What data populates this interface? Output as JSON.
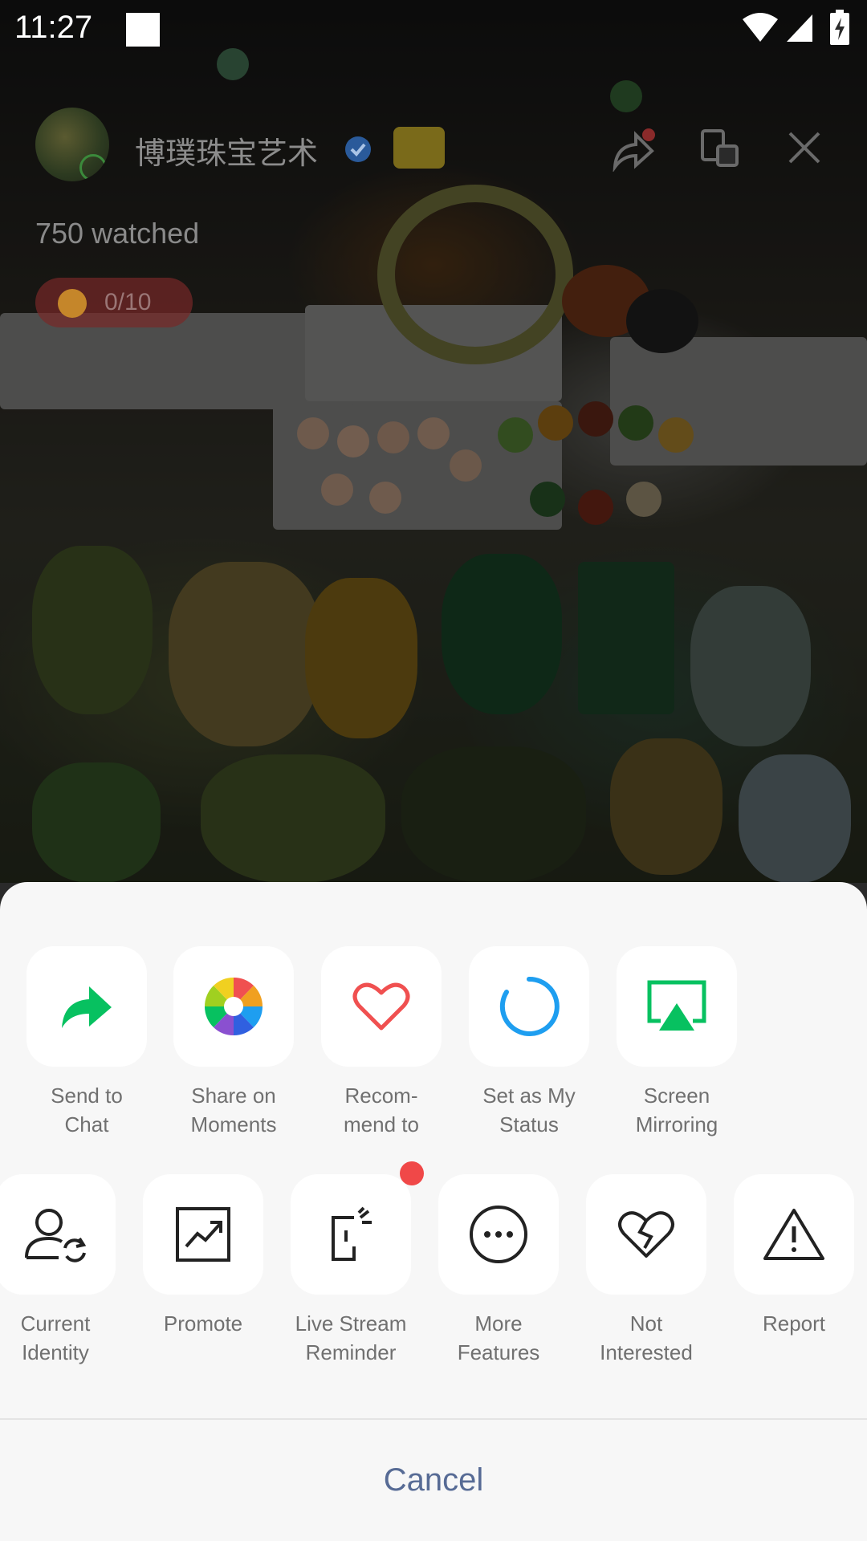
{
  "status_bar": {
    "time": "11:27"
  },
  "live": {
    "streamer_name": "博璞珠宝艺术",
    "watched": "750 watched",
    "task_count": "0/10"
  },
  "share_sheet": {
    "row1": [
      {
        "label": "Send to\nChat",
        "icon": "forward-arrow-icon",
        "color": "#07c160"
      },
      {
        "label": "Share on\nMoments",
        "icon": "moments-aperture-icon"
      },
      {
        "label": "Recom-\nmend to",
        "icon": "heart-icon",
        "color": "#f05050"
      },
      {
        "label": "Set as My\nStatus",
        "icon": "status-ring-icon",
        "color": "#1e9ef0"
      },
      {
        "label": "Screen\nMirroring",
        "icon": "screen-mirroring-icon",
        "color": "#07c160"
      }
    ],
    "row2": [
      {
        "label": "Current\nIdentity",
        "icon": "identity-switch-icon"
      },
      {
        "label": "Promote",
        "icon": "promote-chart-icon"
      },
      {
        "label": "Live Stream\nReminder",
        "icon": "reminder-phone-icon",
        "badge": "red-dot"
      },
      {
        "label": "More\nFeatures",
        "icon": "more-dots-icon"
      },
      {
        "label": "Not\nInterested",
        "icon": "broken-heart-icon"
      },
      {
        "label": "Report",
        "icon": "warning-icon"
      }
    ],
    "cancel_label": "Cancel"
  }
}
